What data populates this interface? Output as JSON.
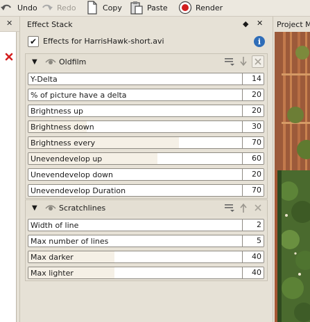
{
  "toolbar": {
    "undo": "Undo",
    "redo": "Redo",
    "copy": "Copy",
    "paste": "Paste",
    "render": "Render"
  },
  "left_panel": {
    "close_glyph": "✕",
    "delete_glyph": "✖"
  },
  "effect_stack": {
    "title": "Effect Stack",
    "float_glyph": "◆",
    "close_glyph": "✕",
    "enable_label": "Effects for HarrisHawk-short.avi",
    "enable_checked": "✔",
    "info_glyph": "i",
    "effects": [
      {
        "name": "Oldfilm",
        "collapse_glyph": "▼",
        "params": [
          {
            "label": "Y-Delta",
            "value": "14",
            "level": 0
          },
          {
            "label": "% of picture have a delta",
            "value": "20",
            "level": 0
          },
          {
            "label": "Brightness up",
            "value": "20",
            "level": 0
          },
          {
            "label": "Brightness down",
            "value": "30",
            "level": 0.27
          },
          {
            "label": "Brightness every",
            "value": "70",
            "level": 0.7
          },
          {
            "label": "Unevendevelop up",
            "value": "60",
            "level": 0.6
          },
          {
            "label": "Unevendevelop down",
            "value": "20",
            "level": 0
          },
          {
            "label": "Unevendevelop Duration",
            "value": "70",
            "level": 0
          }
        ]
      },
      {
        "name": "Scratchlines",
        "collapse_glyph": "▼",
        "params": [
          {
            "label": "Width of line",
            "value": "2",
            "level": 0
          },
          {
            "label": "Max number of lines",
            "value": "5",
            "level": 0
          },
          {
            "label": "Max darker",
            "value": "40",
            "level": 0.4
          },
          {
            "label": "Max lighter",
            "value": "40",
            "level": 0.4
          }
        ]
      }
    ]
  },
  "monitor": {
    "title": "Project M"
  },
  "colors": {
    "panel_bg": "#e6e1d6",
    "render_red": "#d11e1e",
    "info_blue": "#2f6db8"
  }
}
